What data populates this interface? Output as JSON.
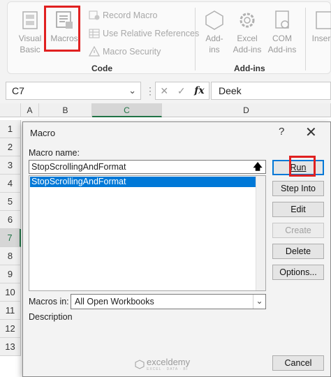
{
  "ribbon": {
    "visual_basic": "Visual\nBasic",
    "macros": "Macros",
    "record_macro": "Record Macro",
    "use_relative_references": "Use Relative References",
    "macro_security": "Macro Security",
    "code_group": "Code",
    "add_ins": "Add-\nins",
    "excel_add_ins": "Excel\nAdd-ins",
    "com_add_ins": "COM\nAdd-ins",
    "insert": "Inser",
    "addins_group": "Add-ins"
  },
  "formula_bar": {
    "name_box": "C7",
    "formula_value": "Deek"
  },
  "grid": {
    "columns": [
      "A",
      "B",
      "C",
      "D"
    ],
    "rows": [
      "1",
      "2",
      "3",
      "4",
      "5",
      "6",
      "7",
      "8",
      "9",
      "10",
      "11",
      "12",
      "13"
    ]
  },
  "dialog": {
    "title": "Macro",
    "help": "?",
    "close": "✕",
    "macro_name_label": "Macro name:",
    "macro_name_value": "StopScrollingAndFormat",
    "macro_list": [
      "StopScrollingAndFormat"
    ],
    "buttons": {
      "run": "Run",
      "step_into": "Step Into",
      "edit": "Edit",
      "create": "Create",
      "delete": "Delete",
      "options": "Options...",
      "cancel": "Cancel"
    },
    "macros_in_label": "Macros in:",
    "macros_in_value": "All Open Workbooks",
    "description_label": "Description"
  },
  "watermark": {
    "brand": "exceldemy",
    "tagline": "EXCEL · DATA · BI"
  },
  "colors": {
    "highlight": "#e02020",
    "selection": "#0078d7",
    "excel_green": "#217346"
  }
}
